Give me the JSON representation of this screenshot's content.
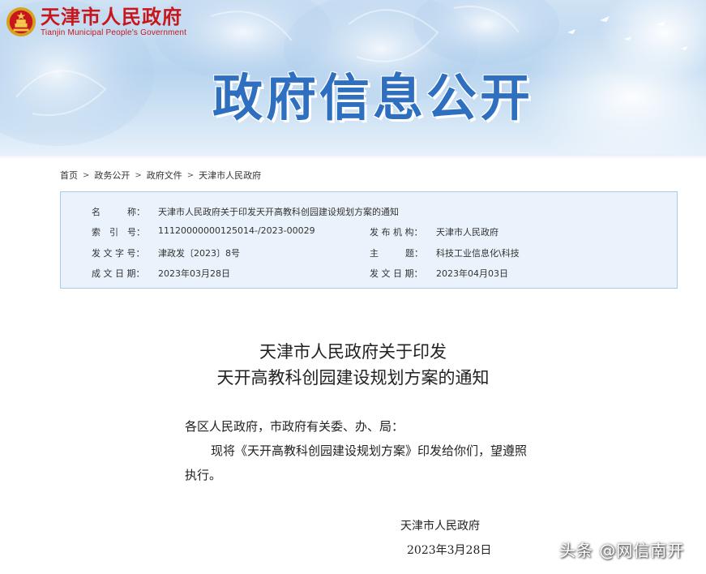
{
  "header": {
    "site_name_cn": "天津市人民政府",
    "site_name_en": "Tianjin Municipal People's Government",
    "banner_title": "政府信息公开",
    "brand_color": "#c8161d",
    "title_color": "#2f6fc0"
  },
  "breadcrumb": {
    "items": [
      "首页",
      "政务公开",
      "政府文件",
      "天津市人民政府"
    ],
    "separator": ">"
  },
  "info": {
    "name_label": "名　　　称：",
    "name_value": "天津市人民政府关于印发天开高教科创园建设规划方案的通知",
    "index_label": "索　引　号：",
    "index_value": "11120000000125014-/2023-00029",
    "issuer_label": "发 布 机 构：",
    "issuer_value": "天津市人民政府",
    "doc_no_label": "发 文 字 号：",
    "doc_no_value": "津政发〔2023〕8号",
    "topic_label": "主　　　题：",
    "topic_value": "科技工业信息化\\科技",
    "created_label": "成 文 日 期：",
    "created_value": "2023年03月28日",
    "published_label": "发 文 日 期：",
    "published_value": "2023年04月03日"
  },
  "article": {
    "title_line1": "天津市人民政府关于印发",
    "title_line2": "天开高教科创园建设规划方案的通知",
    "salutation": "各区人民政府，市政府有关委、办、局：",
    "body_line1": "现将《天开高教科创园建设规划方案》印发给你们，望遵照",
    "body_line2": "执行。",
    "signature": "天津市人民政府",
    "date": "2023年3月28日"
  },
  "watermark": "头条 @网信南开"
}
